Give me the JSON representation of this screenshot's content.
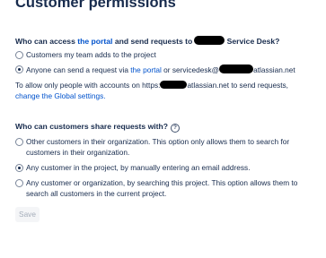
{
  "page": {
    "title": "Customer permissions"
  },
  "access_section": {
    "q_prefix": "Who can access",
    "q_link": "the portal",
    "q_middle": "and send requests to",
    "q_suffix": "Service Desk?",
    "options": [
      {
        "label": "Customers my team adds to the project",
        "checked": false
      },
      {
        "label_prefix": "Anyone can send a request via",
        "label_link": "the portal",
        "label_middle": "or servicedesk@",
        "label_suffix": "atlassian.net",
        "checked": true
      }
    ],
    "note_prefix": "To allow only people with accounts on https:",
    "note_suffix": "atlassian.net to send requests,",
    "note_link": "change the Global settings."
  },
  "share_section": {
    "question": "Who can customers share requests with?",
    "help_icon": "question-circle-icon",
    "options": [
      {
        "label": "Other customers in their organization. This option only allows them to search for customers in their organization.",
        "checked": false
      },
      {
        "label": "Any customer in the project, by manually entering an email address.",
        "checked": true
      },
      {
        "label": "Any customer or organization, by searching this project. This option allows them to search all customers in the current project.",
        "checked": false
      }
    ]
  },
  "actions": {
    "save_label": "Save"
  }
}
